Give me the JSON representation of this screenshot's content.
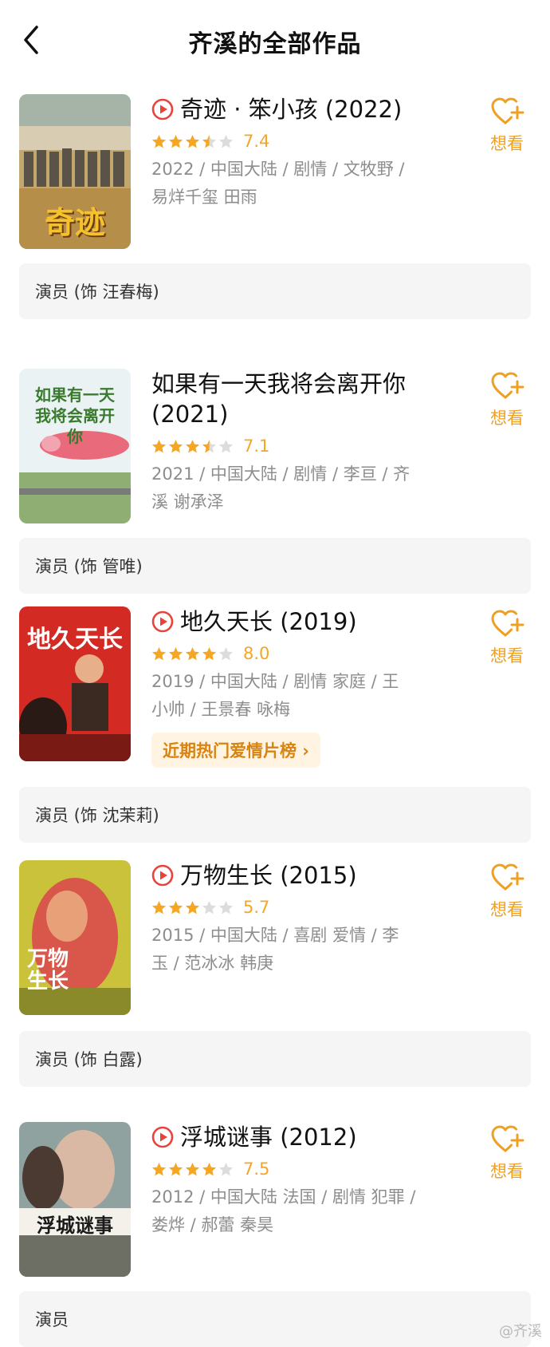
{
  "header": {
    "title": "齐溪的全部作品"
  },
  "colors": {
    "accent": "#f5a623",
    "play": "#e8433a",
    "star_empty": "#dcdcdc"
  },
  "want_label": "想看",
  "movies": [
    {
      "title": "奇迹 · 笨小孩 (2022)",
      "has_play": true,
      "stars": 3.5,
      "score": "7.4",
      "meta": [
        "2022 / 中国大陆 / 剧情 / 文牧野 /",
        "易烊千玺 田雨"
      ],
      "role": "演员 (饰 汪春梅)",
      "poster_text": "奇迹"
    },
    {
      "title": "如果有一天我将会离开你",
      "title_line2": "(2021)",
      "has_play": false,
      "stars": 3.5,
      "score": "7.1",
      "meta": [
        "2021 / 中国大陆 / 剧情 / 李亘 / 齐",
        "溪 谢承泽"
      ],
      "role": "演员 (饰 管唯)",
      "poster_text": "如果有一天 我将会离开你"
    },
    {
      "title": "地久天长 (2019)",
      "has_play": true,
      "stars": 4,
      "score": "8.0",
      "meta": [
        "2019 / 中国大陆 / 剧情 家庭 / 王",
        "小帅 / 王景春 咏梅"
      ],
      "hot_tag": "近期热门爱情片榜 ›",
      "role": "演员 (饰 沈茉莉)",
      "poster_text": "地久天长"
    },
    {
      "title": "万物生长 (2015)",
      "has_play": true,
      "stars": 3,
      "score": "5.7",
      "meta": [
        "2015 / 中国大陆 / 喜剧 爱情 / 李",
        "玉 / 范冰冰 韩庚"
      ],
      "role": "演员 (饰 白露)",
      "poster_text": "万物生长"
    },
    {
      "title": "浮城谜事 (2012)",
      "has_play": true,
      "stars": 4,
      "score": "7.5",
      "meta": [
        "2012 / 中国大陆 法国 / 剧情 犯罪 /",
        "娄烨 / 郝蕾 秦昊"
      ],
      "role": "演员",
      "poster_text": "浮城谜事"
    }
  ],
  "watermark": "@齐溪"
}
